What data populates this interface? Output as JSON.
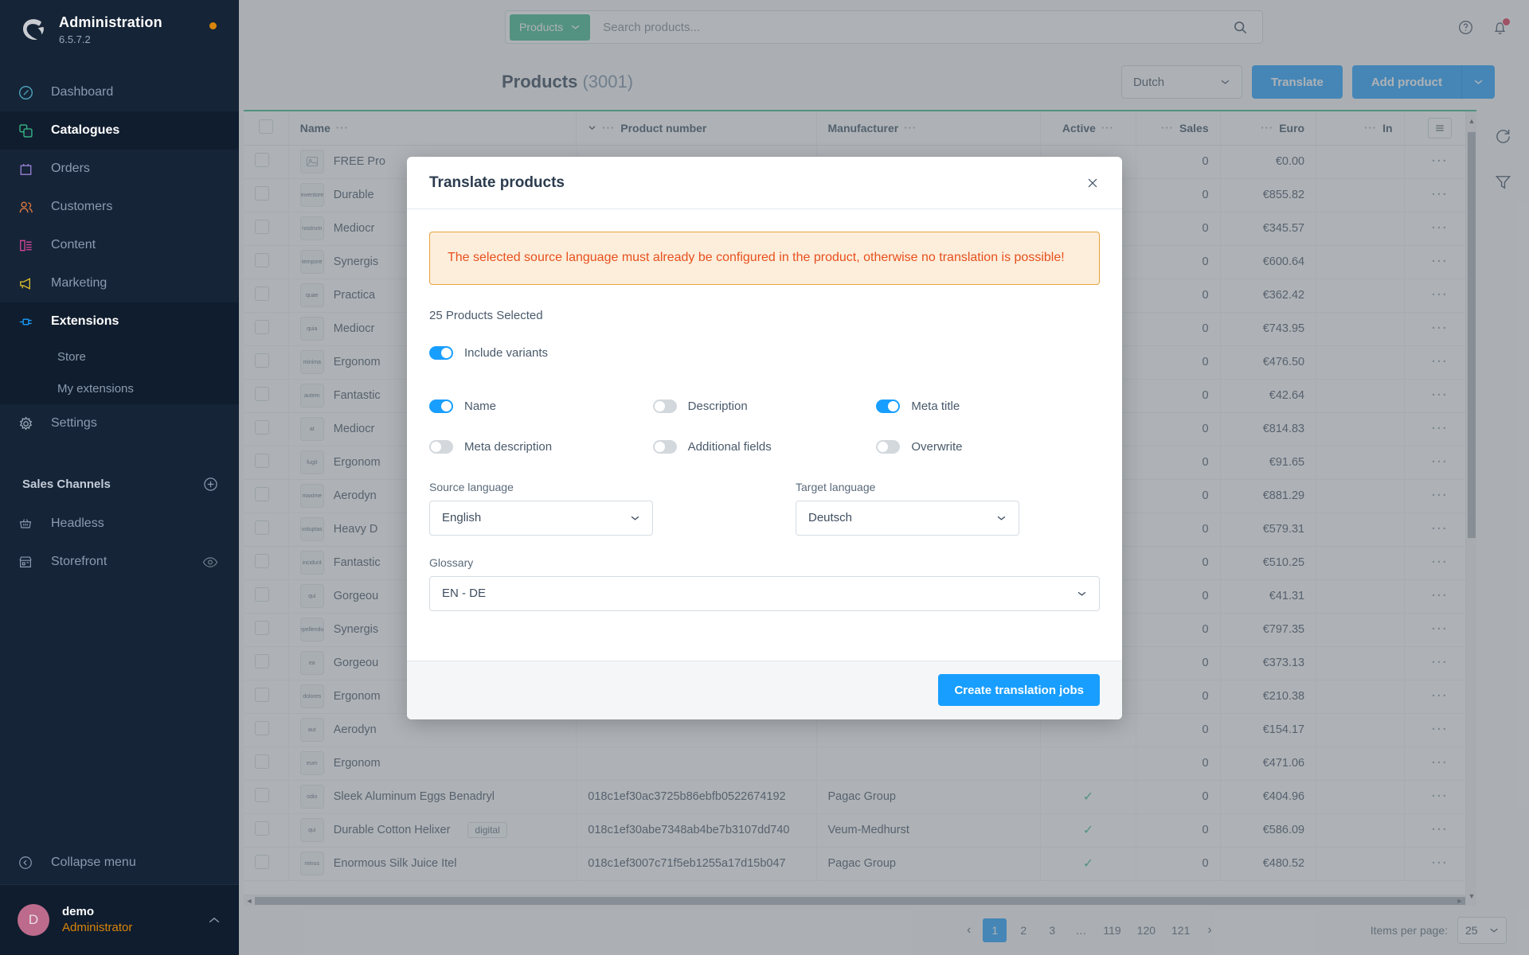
{
  "sidebar": {
    "brand": {
      "title": "Administration",
      "version": "6.5.7.2"
    },
    "items": [
      {
        "label": "Dashboard",
        "icon": "dashboard-icon"
      },
      {
        "label": "Catalogues",
        "icon": "catalogues-icon"
      },
      {
        "label": "Orders",
        "icon": "orders-icon"
      },
      {
        "label": "Customers",
        "icon": "customers-icon"
      },
      {
        "label": "Content",
        "icon": "content-icon"
      },
      {
        "label": "Marketing",
        "icon": "marketing-icon"
      },
      {
        "label": "Extensions",
        "icon": "extensions-icon"
      },
      {
        "label": "Settings",
        "icon": "settings-icon"
      }
    ],
    "sub_items": [
      {
        "label": "Store"
      },
      {
        "label": "My extensions"
      }
    ],
    "sales_channels_header": "Sales Channels",
    "channels": [
      {
        "label": "Headless",
        "icon": "basket-icon"
      },
      {
        "label": "Storefront",
        "icon": "storefront-icon"
      }
    ],
    "collapse_label": "Collapse menu",
    "user": {
      "initial": "D",
      "name": "demo",
      "role": "Administrator"
    }
  },
  "topbar": {
    "search_scope": "Products",
    "search_placeholder": "Search products...",
    "help_icon": "help-icon",
    "notifications_icon": "bell-icon"
  },
  "pagehead": {
    "title": "Products",
    "count": "(3001)",
    "language": "Dutch",
    "translate_label": "Translate",
    "add_product_label": "Add product"
  },
  "table": {
    "columns": [
      {
        "key": "checkbox",
        "label": ""
      },
      {
        "key": "name",
        "label": "Name"
      },
      {
        "key": "product_number",
        "label": "Product number"
      },
      {
        "key": "manufacturer",
        "label": "Manufacturer"
      },
      {
        "key": "active",
        "label": "Active"
      },
      {
        "key": "sales",
        "label": "Sales"
      },
      {
        "key": "euro",
        "label": "Euro"
      },
      {
        "key": "inventory",
        "label": "In"
      },
      {
        "key": "context",
        "label": ""
      }
    ],
    "rows": [
      {
        "thumb": "",
        "name": "FREE Pro",
        "product_number": "",
        "manufacturer": "",
        "active": false,
        "sales": "0",
        "euro": "€0.00",
        "inventory": "",
        "tag": ""
      },
      {
        "thumb": "inventore",
        "name": "Durable",
        "product_number": "",
        "manufacturer": "",
        "active": false,
        "sales": "0",
        "euro": "€855.82",
        "inventory": "",
        "tag": ""
      },
      {
        "thumb": "nostrum",
        "name": "Mediocr",
        "product_number": "",
        "manufacturer": "",
        "active": false,
        "sales": "0",
        "euro": "€345.57",
        "inventory": "",
        "tag": ""
      },
      {
        "thumb": "tempore",
        "name": "Synergis",
        "product_number": "",
        "manufacturer": "",
        "active": false,
        "sales": "0",
        "euro": "€600.64",
        "inventory": "",
        "tag": ""
      },
      {
        "thumb": "quae",
        "name": "Practica",
        "product_number": "",
        "manufacturer": "",
        "active": false,
        "sales": "0",
        "euro": "€362.42",
        "inventory": "",
        "tag": ""
      },
      {
        "thumb": "quia",
        "name": "Mediocr",
        "product_number": "",
        "manufacturer": "",
        "active": false,
        "sales": "0",
        "euro": "€743.95",
        "inventory": "",
        "tag": ""
      },
      {
        "thumb": "minima",
        "name": "Ergonom",
        "product_number": "",
        "manufacturer": "",
        "active": false,
        "sales": "0",
        "euro": "€476.50",
        "inventory": "",
        "tag": ""
      },
      {
        "thumb": "autem",
        "name": "Fantastic",
        "product_number": "",
        "manufacturer": "",
        "active": false,
        "sales": "0",
        "euro": "€42.64",
        "inventory": "",
        "tag": ""
      },
      {
        "thumb": "at",
        "name": "Mediocr",
        "product_number": "",
        "manufacturer": "",
        "active": false,
        "sales": "0",
        "euro": "€814.83",
        "inventory": "",
        "tag": ""
      },
      {
        "thumb": "fugit",
        "name": "Ergonom",
        "product_number": "",
        "manufacturer": "",
        "active": false,
        "sales": "0",
        "euro": "€91.65",
        "inventory": "",
        "tag": ""
      },
      {
        "thumb": "maxime",
        "name": "Aerodyn",
        "product_number": "",
        "manufacturer": "",
        "active": false,
        "sales": "0",
        "euro": "€881.29",
        "inventory": "",
        "tag": ""
      },
      {
        "thumb": "voluptas",
        "name": "Heavy D",
        "product_number": "",
        "manufacturer": "",
        "active": false,
        "sales": "0",
        "euro": "€579.31",
        "inventory": "",
        "tag": ""
      },
      {
        "thumb": "incidunt",
        "name": "Fantastic",
        "product_number": "",
        "manufacturer": "",
        "active": false,
        "sales": "0",
        "euro": "€510.25",
        "inventory": "",
        "tag": ""
      },
      {
        "thumb": "qui",
        "name": "Gorgeou",
        "product_number": "",
        "manufacturer": "",
        "active": false,
        "sales": "0",
        "euro": "€41.31",
        "inventory": "",
        "tag": ""
      },
      {
        "thumb": "repellendus",
        "name": "Synergis",
        "product_number": "",
        "manufacturer": "",
        "active": false,
        "sales": "0",
        "euro": "€797.35",
        "inventory": "",
        "tag": ""
      },
      {
        "thumb": "ea",
        "name": "Gorgeou",
        "product_number": "",
        "manufacturer": "",
        "active": false,
        "sales": "0",
        "euro": "€373.13",
        "inventory": "",
        "tag": ""
      },
      {
        "thumb": "dolores",
        "name": "Ergonom",
        "product_number": "",
        "manufacturer": "",
        "active": false,
        "sales": "0",
        "euro": "€210.38",
        "inventory": "",
        "tag": ""
      },
      {
        "thumb": "aut",
        "name": "Aerodyn",
        "product_number": "",
        "manufacturer": "",
        "active": false,
        "sales": "0",
        "euro": "€154.17",
        "inventory": "",
        "tag": ""
      },
      {
        "thumb": "eum",
        "name": "Ergonom",
        "product_number": "",
        "manufacturer": "",
        "active": false,
        "sales": "0",
        "euro": "€471.06",
        "inventory": "",
        "tag": ""
      },
      {
        "thumb": "odio",
        "name": "Sleek Aluminum Eggs Benadryl",
        "product_number": "018c1ef30ac3725b86ebfb0522674192",
        "manufacturer": "Pagac Group",
        "active": true,
        "sales": "0",
        "euro": "€404.96",
        "inventory": "",
        "tag": ""
      },
      {
        "thumb": "qui",
        "name": "Durable Cotton Helixer",
        "product_number": "018c1ef30abe7348ab4be7b3107dd740",
        "manufacturer": "Veum-Medhurst",
        "active": true,
        "sales": "0",
        "euro": "€586.09",
        "inventory": "",
        "tag": "digital"
      },
      {
        "thumb": "minus",
        "name": "Enormous Silk Juice Itel",
        "product_number": "018c1ef3007c71f5eb1255a17d15b047",
        "manufacturer": "Pagac Group",
        "active": true,
        "sales": "0",
        "euro": "€480.52",
        "inventory": "",
        "tag": ""
      }
    ]
  },
  "rail": {
    "refresh_icon": "refresh-icon",
    "filter_icon": "filter-icon"
  },
  "pagination": {
    "prev": "‹",
    "next": "›",
    "pages": [
      "1",
      "2",
      "3",
      "…",
      "119",
      "120",
      "121"
    ],
    "active_page": "1",
    "items_per_page_label": "Items per page:",
    "items_per_page_value": "25"
  },
  "modal": {
    "title": "Translate products",
    "close_icon": "close-icon",
    "alert": "The selected source language must already be configured in the product, otherwise no translation is possible!",
    "selection_count": "25 Products Selected",
    "include_variants": {
      "label": "Include variants",
      "on": true
    },
    "switches": [
      {
        "label": "Name",
        "on": true
      },
      {
        "label": "Description",
        "on": false
      },
      {
        "label": "Meta title",
        "on": true
      },
      {
        "label": "Meta description",
        "on": false
      },
      {
        "label": "Additional fields",
        "on": false
      },
      {
        "label": "Overwrite",
        "on": false
      }
    ],
    "source_language": {
      "label": "Source language",
      "value": "English"
    },
    "target_language": {
      "label": "Target language",
      "value": "Deutsch"
    },
    "glossary": {
      "label": "Glossary",
      "value": "EN - DE"
    },
    "submit_label": "Create translation jobs"
  },
  "colors": {
    "accent_blue": "#189eff",
    "sidebar_bg": "#152437",
    "green": "#37b987",
    "alert_text": "#e7501e",
    "alert_bg": "#fdeedb",
    "alert_border": "#e8a33d",
    "role_orange": "#d8850a"
  }
}
